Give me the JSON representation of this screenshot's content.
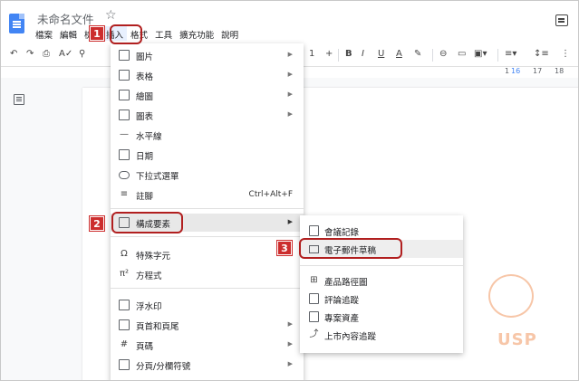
{
  "header": {
    "doc_title": "未命名文件",
    "menu": [
      "檔案",
      "編輯",
      "檢",
      "插入",
      "格式",
      "工具",
      "擴充功能",
      "說明"
    ]
  },
  "toolbar": {
    "font_size": "1",
    "ruler_marks": [
      "1",
      "16",
      "17",
      "18"
    ]
  },
  "insert_menu": {
    "items": [
      {
        "label": "圖片",
        "icon": "image-icon",
        "arrow": true
      },
      {
        "label": "表格",
        "icon": "table-icon",
        "arrow": true
      },
      {
        "label": "繪圖",
        "icon": "drawing-icon",
        "arrow": true
      },
      {
        "label": "圖表",
        "icon": "chart-icon",
        "arrow": true
      },
      {
        "label": "水平線",
        "icon": "horizontal-line-icon"
      },
      {
        "label": "日期",
        "icon": "calendar-icon"
      },
      {
        "label": "下拉式選單",
        "icon": "dropdown-icon"
      },
      {
        "label": "註腳",
        "icon": "footnote-icon",
        "shortcut": "Ctrl+Alt+F"
      },
      {
        "label": "構成要素",
        "icon": "building-blocks-icon",
        "arrow": true
      },
      {
        "label": "特殊字元",
        "icon": "omega-icon"
      },
      {
        "label": "方程式",
        "icon": "pi-icon"
      },
      {
        "label": "浮水印",
        "icon": "watermark-icon"
      },
      {
        "label": "頁首和頁尾",
        "icon": "header-footer-icon",
        "arrow": true
      },
      {
        "label": "頁碼",
        "icon": "hash-icon",
        "arrow": true
      },
      {
        "label": "分頁/分欄符號",
        "icon": "break-icon",
        "arrow": true
      }
    ]
  },
  "building_blocks_submenu": {
    "items": [
      {
        "label": "會議記錄",
        "icon": "meeting-notes-icon"
      },
      {
        "label": "電子郵件草稿",
        "icon": "email-icon"
      },
      {
        "label": "產品路徑圖",
        "icon": "map-icon"
      },
      {
        "label": "評論追蹤",
        "icon": "review-icon"
      },
      {
        "label": "專案資產",
        "icon": "assets-icon"
      },
      {
        "label": "上市內容追蹤",
        "icon": "trend-icon"
      }
    ]
  },
  "steps": [
    "1",
    "2",
    "3"
  ],
  "watermark": {
    "text": "USP"
  },
  "colors": {
    "accent": "#4285f4",
    "step_badge": "#cc2d2d",
    "ring": "#b11f1f"
  }
}
